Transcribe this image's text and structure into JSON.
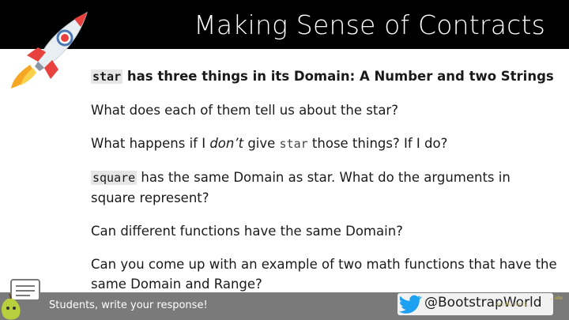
{
  "slide": {
    "title": "Making Sense of Contracts"
  },
  "content": {
    "line1": {
      "code": "star",
      "text": " has three things in its Domain: A Number and two Strings"
    },
    "line2": "What does each of them tell us about the star?",
    "line3": {
      "pre": "What happens if I ",
      "em": "don’t",
      "mid": " give ",
      "code": "star",
      "post": " those things? If I do?"
    },
    "line4": {
      "code": "square",
      "text": " has the same Domain as star. What do the arguments in square represent?"
    },
    "line5": "Can different functions have the same Domain?",
    "line6": "Can you come up with an example of two math functions that have the same Domain and Range?"
  },
  "footer": {
    "prompt": "Students, write your response!",
    "handle": "@BootstrapWorld",
    "watermark_line1": "...ide",
    "watermark_line2": "...on/students..."
  },
  "colors": {
    "title_bg": "#000000",
    "footer_bg": "#7a7a7a",
    "twitter_blue": "#1da1f2",
    "rocket_red": "#e8423f"
  }
}
